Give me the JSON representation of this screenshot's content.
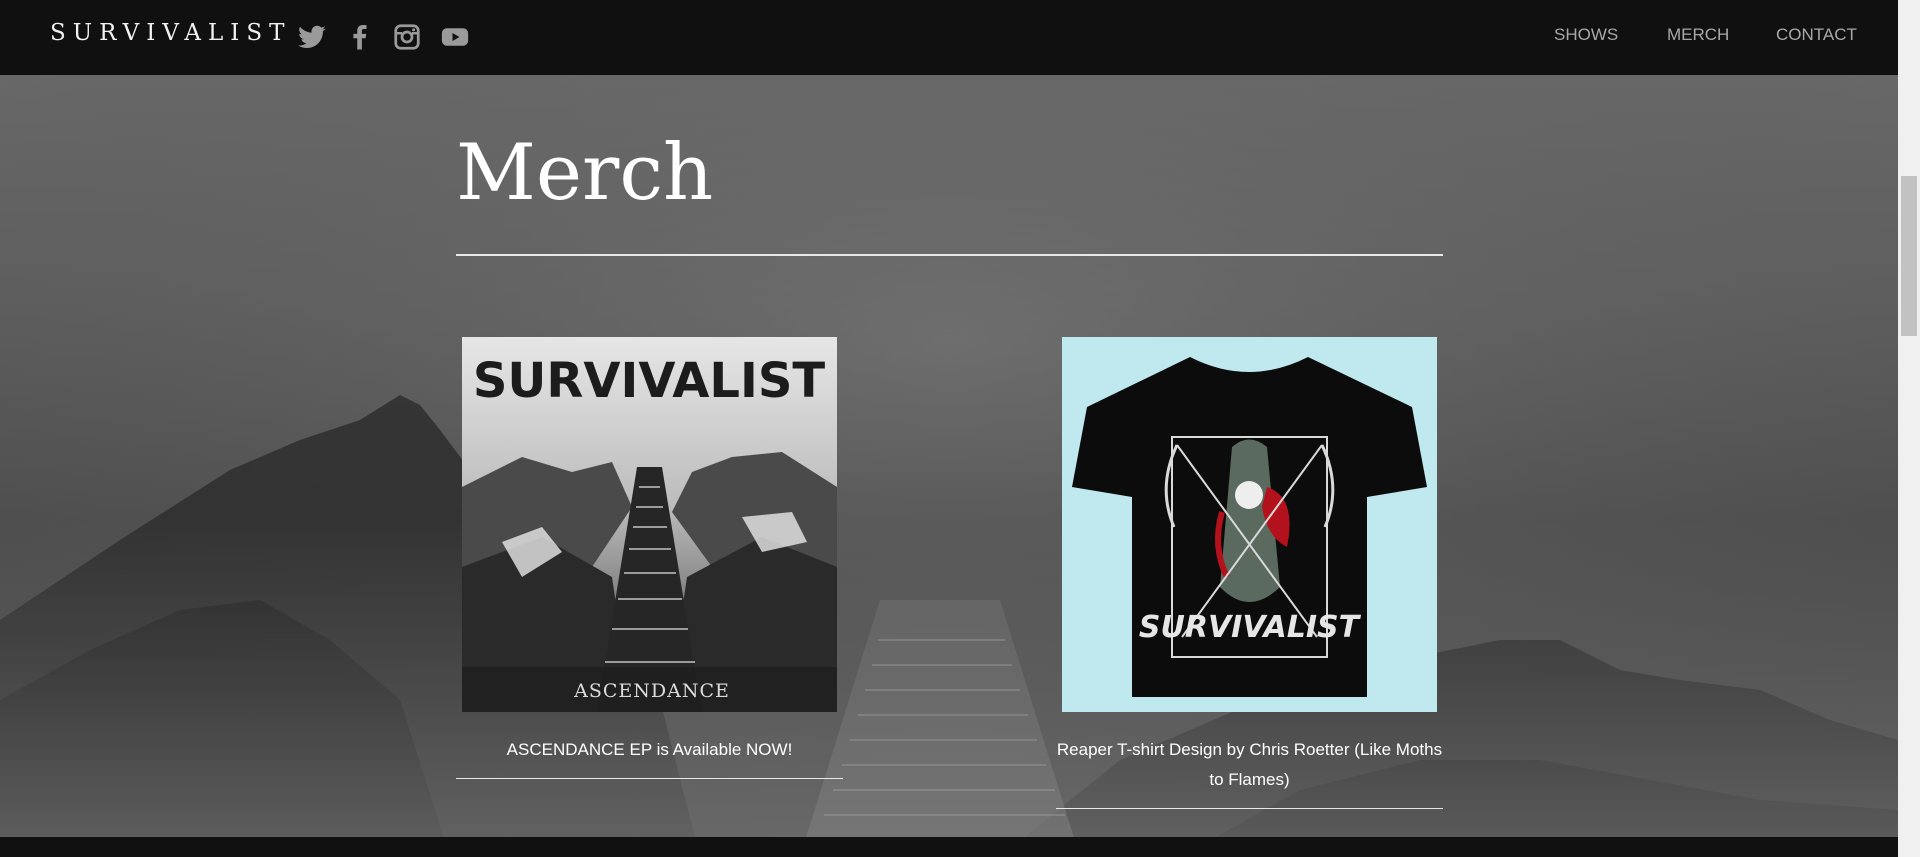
{
  "header": {
    "brand": "SURVIVALIST",
    "social": [
      {
        "icon": "twitter-icon"
      },
      {
        "icon": "facebook-icon"
      },
      {
        "icon": "instagram-icon"
      },
      {
        "icon": "youtube-icon"
      }
    ],
    "nav": [
      "SHOWS",
      "MERCH",
      "CONTACT"
    ]
  },
  "main": {
    "title": "Merch",
    "items": [
      {
        "image_text_top": "SURVIVALIST",
        "image_text_bottom": "ASCENDANCE",
        "caption": "ASCENDANCE EP is Available NOW!"
      },
      {
        "image_text": "SURVIVALIST",
        "caption_line1": "Reaper T-shirt Design by Chris Roetter (Like Moths",
        "caption_line2": "to Flames)"
      }
    ]
  },
  "colors": {
    "header_bg": "#101010",
    "text": "#ffffff",
    "nav": "#a8a8a8",
    "shirt_bg": "#bfe9ee"
  }
}
